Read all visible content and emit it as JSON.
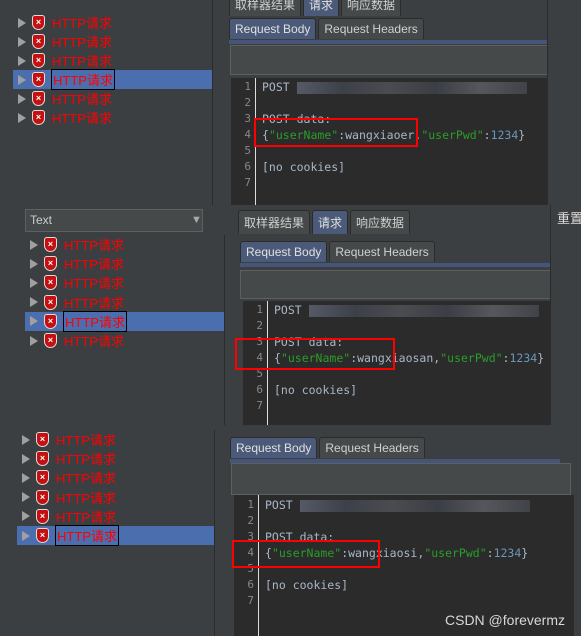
{
  "top_tabs": [
    "取样器结果",
    "请求",
    "响应数据"
  ],
  "sub_tabs": [
    "Request Body",
    "Request Headers"
  ],
  "reset_label": "重置",
  "combo_value": "Text",
  "tree_item_label": "HTTP请求",
  "error_icon": "shield-error-icon",
  "panels": [
    {
      "selected": 3,
      "items": 6,
      "lines": [
        "POST",
        "",
        "POST data:",
        "{\"userName\":wangxiaoer,\"userPwd\":1234}",
        "",
        "[no cookies]",
        ""
      ],
      "username": "wangxiaoer"
    },
    {
      "selected": 4,
      "items": 6,
      "lines": [
        "POST",
        "",
        "POST data:",
        "{\"userName\":wangxiaosan,\"userPwd\":1234}",
        "",
        "[no cookies]",
        ""
      ],
      "username": "wangxiaosan"
    },
    {
      "selected": 5,
      "items": 6,
      "lines": [
        "POST",
        "",
        "POST data:",
        "{\"userName\":wangxiaosi,\"userPwd\":1234}",
        "",
        "[no cookies]",
        ""
      ],
      "username": "wangxiaosi"
    }
  ],
  "code": {
    "key_user": "\"userName\"",
    "key_pwd": "\"userPwd\"",
    "pwd": "1234",
    "post_data": "POST data:",
    "no_cookies": "[no cookies]",
    "post": "POST"
  },
  "colors": {
    "selection": "#4b6eaf",
    "error_text": "#ff0000",
    "highlight_box": "#ff0000",
    "string": "#2a9d2a"
  },
  "watermark": "CSDN @forevermz"
}
